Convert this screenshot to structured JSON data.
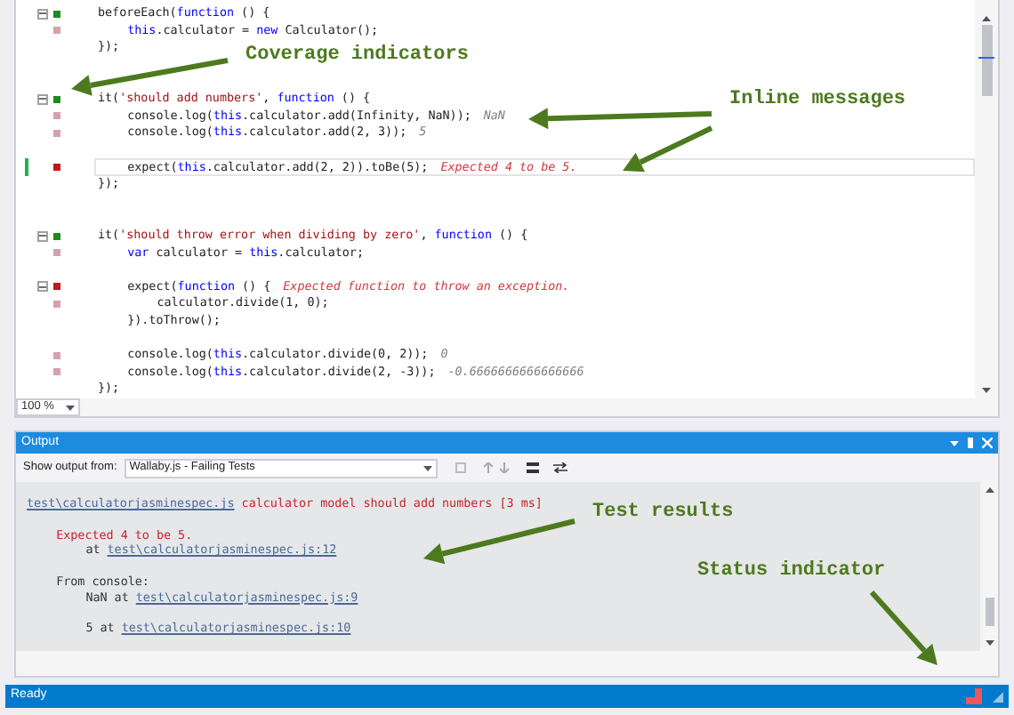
{
  "editor": {
    "lines": [
      {
        "kind": "code",
        "color": "#1f8a1f",
        "foldable": true,
        "current": false,
        "modified": false,
        "code": [
          {
            "text": "beforeEach(",
            "kind": "plain"
          },
          {
            "text": "function",
            "kind": "keyword"
          },
          {
            "text": " () {",
            "kind": "plain"
          }
        ],
        "children": [
          {
            "kind": "code",
            "color": "#d7a1aa",
            "foldable": false,
            "current": false,
            "modified": false,
            "code": [
              {
                "text": "this",
                "kind": "keyword"
              },
              {
                "text": ".calculator = ",
                "kind": "plain"
              },
              {
                "text": "new",
                "kind": "keyword"
              },
              {
                "text": " Calculator();",
                "kind": "plain"
              }
            ]
          }
        ]
      },
      {
        "kind": "code",
        "foldable": false,
        "current": false,
        "modified": false,
        "code": [
          {
            "text": "});",
            "kind": "plain"
          }
        ]
      },
      {
        "kind": "blank"
      },
      {
        "kind": "blank"
      },
      {
        "kind": "code",
        "color": "#1f8a1f",
        "foldable": true,
        "current": false,
        "modified": false,
        "code": [
          {
            "text": "it(",
            "kind": "plain"
          },
          {
            "text": "'should add numbers'",
            "kind": "string"
          },
          {
            "text": ", ",
            "kind": "plain"
          },
          {
            "text": "function",
            "kind": "keyword"
          },
          {
            "text": " () {",
            "kind": "plain"
          }
        ],
        "children": [
          {
            "kind": "code",
            "color": "#d7a1aa",
            "foldable": false,
            "current": false,
            "modified": false,
            "code": [
              {
                "text": "console.log(",
                "kind": "plain"
              },
              {
                "text": "this",
                "kind": "keyword"
              },
              {
                "text": ".calculator.add(Infinity, NaN));",
                "kind": "plain"
              }
            ],
            "message": {
              "text": "NaN",
              "kind": "log"
            }
          },
          {
            "kind": "code",
            "color": "#d7a1aa",
            "foldable": false,
            "current": false,
            "modified": false,
            "code": [
              {
                "text": "console.log(",
                "kind": "plain"
              },
              {
                "text": "this",
                "kind": "keyword"
              },
              {
                "text": ".calculator.add(2, 3));",
                "kind": "plain"
              }
            ],
            "message": {
              "text": "5",
              "kind": "log"
            }
          },
          {
            "kind": "blank"
          },
          {
            "kind": "code",
            "color": "#c4161c",
            "foldable": false,
            "current": true,
            "modified": true,
            "code": [
              {
                "text": "expect(",
                "kind": "plain"
              },
              {
                "text": "this",
                "kind": "keyword"
              },
              {
                "text": ".calculator.add(2, 2)).toBe(5);",
                "kind": "plain"
              }
            ],
            "message": {
              "text": "Expected 4 to be 5.",
              "kind": "error"
            }
          }
        ]
      },
      {
        "kind": "code",
        "foldable": false,
        "current": false,
        "modified": false,
        "code": [
          {
            "text": "});",
            "kind": "plain"
          }
        ]
      },
      {
        "kind": "blank"
      },
      {
        "kind": "blank"
      },
      {
        "kind": "code",
        "color": "#1f8a1f",
        "foldable": true,
        "current": false,
        "modified": false,
        "code": [
          {
            "text": "it(",
            "kind": "plain"
          },
          {
            "text": "'should throw error when dividing by zero'",
            "kind": "string"
          },
          {
            "text": ", ",
            "kind": "plain"
          },
          {
            "text": "function",
            "kind": "keyword"
          },
          {
            "text": " () {",
            "kind": "plain"
          }
        ],
        "children": [
          {
            "kind": "code",
            "color": "#d7a1aa",
            "foldable": false,
            "current": false,
            "modified": false,
            "code": [
              {
                "text": "var",
                "kind": "keyword"
              },
              {
                "text": " calculator = ",
                "kind": "plain"
              },
              {
                "text": "this",
                "kind": "keyword"
              },
              {
                "text": ".calculator;",
                "kind": "plain"
              }
            ]
          },
          {
            "kind": "blank"
          },
          {
            "kind": "code",
            "color": "#c4161c",
            "foldable": true,
            "current": false,
            "modified": false,
            "code": [
              {
                "text": "expect(",
                "kind": "plain"
              },
              {
                "text": "function",
                "kind": "keyword"
              },
              {
                "text": " () {",
                "kind": "plain"
              }
            ],
            "message": {
              "text": "Expected function to throw an exception.",
              "kind": "error"
            },
            "children": [
              {
                "kind": "code",
                "color": "#d7a1aa",
                "foldable": false,
                "current": false,
                "modified": false,
                "code": [
                  {
                    "text": "calculator.divide(1, 0);",
                    "kind": "plain"
                  }
                ]
              }
            ]
          },
          {
            "kind": "code",
            "foldable": false,
            "current": false,
            "modified": false,
            "code": [
              {
                "text": "}).toThrow();",
                "kind": "plain"
              }
            ]
          },
          {
            "kind": "blank"
          },
          {
            "kind": "code",
            "color": "#d7a1aa",
            "foldable": false,
            "current": false,
            "modified": false,
            "code": [
              {
                "text": "console.log(",
                "kind": "plain"
              },
              {
                "text": "this",
                "kind": "keyword"
              },
              {
                "text": ".calculator.divide(0, 2));",
                "kind": "plain"
              }
            ],
            "message": {
              "text": "0",
              "kind": "log"
            }
          },
          {
            "kind": "code",
            "color": "#d7a1aa",
            "foldable": false,
            "current": false,
            "modified": false,
            "code": [
              {
                "text": "console.log(",
                "kind": "plain"
              },
              {
                "text": "this",
                "kind": "keyword"
              },
              {
                "text": ".calculator.divide(2, -3));",
                "kind": "plain"
              }
            ],
            "message": {
              "text": "-0.6666666666666666",
              "kind": "log"
            }
          }
        ]
      },
      {
        "kind": "code",
        "foldable": false,
        "current": false,
        "modified": false,
        "code": [
          {
            "text": "});",
            "kind": "plain"
          }
        ]
      }
    ],
    "zoom": "100 %"
  },
  "output": {
    "title": "Output",
    "show_output_label": "Show output from:",
    "source": "Wallaby.js - Failing Tests",
    "lines": [
      {
        "kind": "header",
        "link": "test\\calculatorjasminespec.js",
        "text": " calculator model should add numbers [3 ms]"
      },
      {
        "kind": "blank"
      },
      {
        "kind": "error",
        "text": "Expected 4 to be 5.",
        "children": [
          {
            "kind": "text",
            "text": "at ",
            "link": "test\\calculatorjasminespec.js:12"
          }
        ]
      },
      {
        "kind": "blank"
      },
      {
        "kind": "text",
        "text": "From console:",
        "children": [
          {
            "kind": "text",
            "text": "NaN at ",
            "link": "test\\calculatorjasminespec.js:9"
          },
          {
            "kind": "blank"
          },
          {
            "kind": "text",
            "text": "5 at ",
            "link": "test\\calculatorjasminespec.js:10"
          }
        ]
      }
    ]
  },
  "status_bar": {
    "text": "Ready",
    "indicator": {
      "color": "#f0545c"
    }
  },
  "annotations": [
    "Coverage indicators",
    "Inline messages",
    "Test results",
    "Status indicator"
  ]
}
